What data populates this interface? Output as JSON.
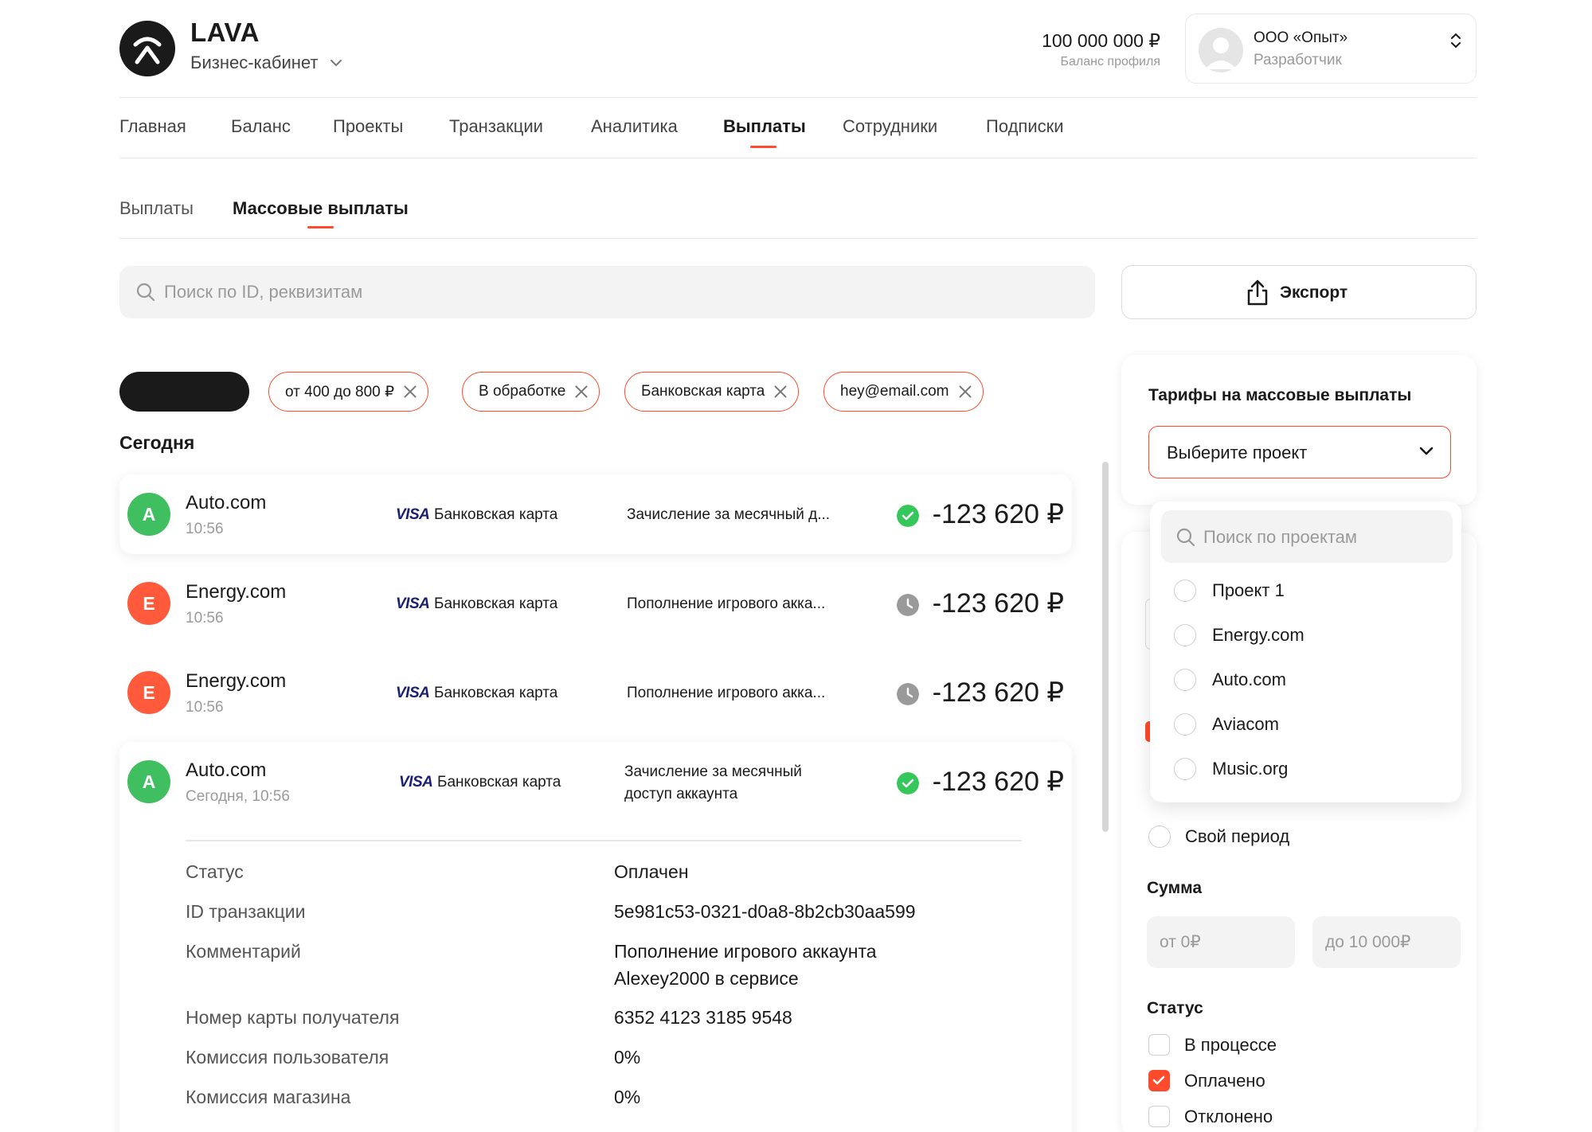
{
  "header": {
    "brand": "LAVA",
    "subbrand": "Бизнес-кабинет",
    "balance": "100 000 000 ₽",
    "balance_label": "Баланс профиля",
    "account_name": "ООО «Опыт»",
    "account_role": "Разработчик"
  },
  "nav": {
    "items": [
      "Главная",
      "Баланс",
      "Проекты",
      "Транзакции",
      "Аналитика",
      "Выплаты",
      "Сотрудники",
      "Подписки"
    ],
    "active": "Выплаты"
  },
  "subnav": {
    "items": [
      "Выплаты",
      "Массовые выплаты"
    ],
    "active": "Массовые выплаты"
  },
  "search": {
    "placeholder": "Поиск по ID, реквизитам"
  },
  "export": {
    "label": "Экспорт"
  },
  "chips": [
    "от 400 до 800 ₽",
    "В обработке",
    "Банковская карта",
    "hey@email.com"
  ],
  "section_title": "Сегодня",
  "transactions": [
    {
      "initial": "A",
      "name": "Auto.com",
      "time": "10:56",
      "card_brand": "VISA",
      "method": "Банковская карта",
      "description": "Зачисление за месячный д...",
      "status": "success",
      "amount": "-123 620 ₽"
    },
    {
      "initial": "E",
      "name": "Energy.com",
      "time": "10:56",
      "card_brand": "VISA",
      "method": "Банковская карта",
      "description": "Пополнение игрового акка...",
      "status": "pending",
      "amount": "-123 620 ₽"
    },
    {
      "initial": "E",
      "name": "Energy.com",
      "time": "10:56",
      "card_brand": "VISA",
      "method": "Банковская карта",
      "description": "Пополнение игрового акка...",
      "status": "pending",
      "amount": "-123 620 ₽"
    },
    {
      "initial": "A",
      "name": "Auto.com",
      "time": "Сегодня, 10:56",
      "card_brand": "VISA",
      "method": "Банковская карта",
      "description_line1": "Зачисление за месячный",
      "description_line2": "доступ аккаунта",
      "status": "success",
      "amount": "-123 620 ₽"
    }
  ],
  "details": [
    {
      "label": "Статус",
      "value": "Оплачен"
    },
    {
      "label": "ID транзакции",
      "value": "5e981c53-0321-d0a8-8b2cb30aa599"
    },
    {
      "label": "Комментарий",
      "value_line1": "Пополнение игрового аккаунта",
      "value_line2": "Alexey2000 в сервисе"
    },
    {
      "label": "Номер карты получателя",
      "value": "6352 4123 3185 9548"
    },
    {
      "label": "Комиссия пользователя",
      "value": "0%"
    },
    {
      "label": "Комиссия магазина",
      "value": "0%"
    }
  ],
  "tariffs": {
    "title": "Тарифы на массовые выплаты",
    "select_label": "Выберите проект",
    "dropdown_search_placeholder": "Поиск по проектам",
    "projects": [
      "Проект 1",
      "Energy.com",
      "Auto.com",
      "Aviacom",
      "Music.org"
    ]
  },
  "filters": {
    "period_own": "Свой период",
    "sum_title": "Сумма",
    "sum_from_placeholder": "от 0₽",
    "sum_to_placeholder": "до 10 000₽",
    "status_title": "Статус",
    "statuses": [
      {
        "label": "В процессе",
        "checked": false
      },
      {
        "label": "Оплачено",
        "checked": true
      },
      {
        "label": "Отклонено",
        "checked": false
      }
    ]
  },
  "colors": {
    "accent": "#ff4a2b",
    "success": "#34c759",
    "pending": "#9a9a9a",
    "avatar_a": "#3fbf5f",
    "avatar_e": "#ff5a3c",
    "dark": "#1a1a1a"
  }
}
